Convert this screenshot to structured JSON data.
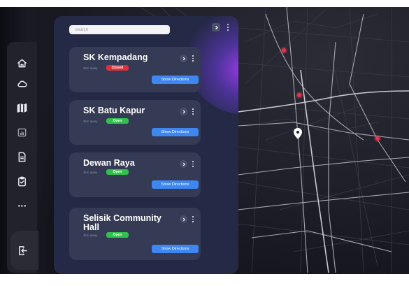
{
  "colors": {
    "accent": "#3e86f0",
    "closed": "#e0303a",
    "open": "#2fc14c",
    "panel": "#242946",
    "card": "#353a55",
    "map_marker": "#e2364a"
  },
  "search": {
    "placeholder": "Search"
  },
  "sidebar": {
    "items": [
      {
        "icon": "home-icon"
      },
      {
        "icon": "cloud-icon"
      },
      {
        "icon": "map-icon"
      },
      {
        "icon": "chart-icon"
      },
      {
        "icon": "document-icon"
      },
      {
        "icon": "clipboard-icon"
      },
      {
        "icon": "more-icon"
      }
    ],
    "exit_icon": "logout-icon"
  },
  "locations": [
    {
      "name": "SK Kempadang",
      "distance": "2km away",
      "status": "Closed",
      "directions": "Show Directions"
    },
    {
      "name": "SK Batu Kapur",
      "distance": "2km away",
      "status": "Open",
      "directions": "Show Directions"
    },
    {
      "name": "Dewan Raya",
      "distance": "2km away",
      "status": "Open",
      "directions": "Show Directions"
    },
    {
      "name": "Selisik Community Hall",
      "distance": "2km away",
      "status": "Open",
      "directions": "Show Directions"
    }
  ]
}
